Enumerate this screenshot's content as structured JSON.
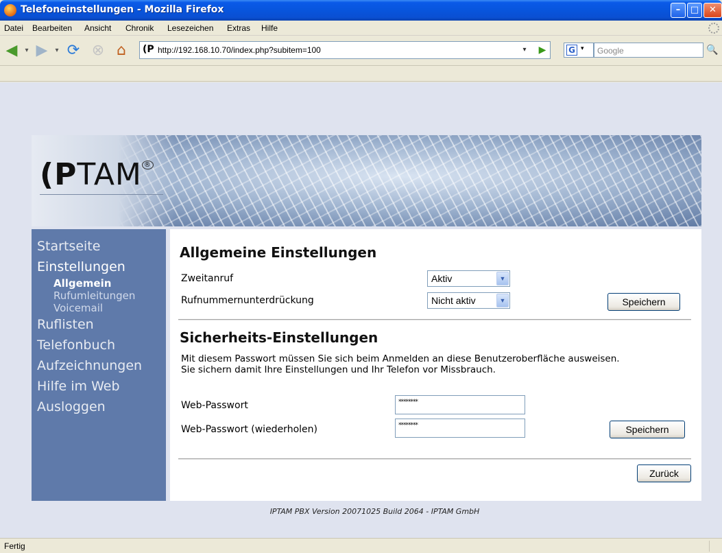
{
  "window": {
    "title": "Telefoneinstellungen - Mozilla Firefox",
    "buttons": {
      "minimize": "–",
      "maximize": "□",
      "close": "✕"
    }
  },
  "menu": [
    "Datei",
    "Bearbeiten",
    "Ansicht",
    "Chronik",
    "Lesezeichen",
    "Extras",
    "Hilfe"
  ],
  "nav": {
    "url": "http://192.168.10.70/index.php?subitem=100",
    "search_placeholder": "Google",
    "icons": {
      "back": "◀",
      "drop": "▾",
      "forward": "▶",
      "reload": "⟳",
      "stop": "⊗",
      "home": "⌂",
      "favicon": "(P",
      "go": "▶",
      "search_engine": "G",
      "search": "🔍"
    }
  },
  "logo": {
    "bold": "(P",
    "light": "TAM",
    "registered": "®"
  },
  "sidebar": {
    "items": [
      {
        "label": "Startseite",
        "active": false
      },
      {
        "label": "Einstellungen",
        "active": true
      },
      {
        "label": "Ruflisten",
        "active": false
      },
      {
        "label": "Telefonbuch",
        "active": false
      },
      {
        "label": "Aufzeichnungen",
        "active": false
      },
      {
        "label": "Hilfe im Web",
        "active": false
      },
      {
        "label": "Ausloggen",
        "active": false
      }
    ],
    "subitems": [
      {
        "label": "Allgemein",
        "active": true
      },
      {
        "label": "Rufumleitungen",
        "active": false
      },
      {
        "label": "Voicemail",
        "active": false
      }
    ]
  },
  "general": {
    "title": "Allgemeine Einstellungen",
    "call_waiting_label": "Zweitanruf",
    "call_waiting_value": "Aktiv",
    "clir_label": "Rufnummernunterdrückung",
    "clir_value": "Nicht aktiv",
    "save_label": "Speichern",
    "select_arrow": "▼"
  },
  "security": {
    "title": "Sicherheits-Einstellungen",
    "description": "Mit diesem Passwort müssen Sie sich beim Anmelden an diese Benutzeroberfläche ausweisen. Sie sichern damit Ihre Einstellungen und Ihr Telefon vor Missbrauch.",
    "password_label": "Web-Passwort",
    "password_repeat_label": "Web-Passwort (wiederholen)",
    "password_value": "********",
    "save_label": "Speichern"
  },
  "back_label": "Zurück",
  "footer": "IPTAM PBX Version 20071025 Build 2064 - IPTAM GmbH",
  "status": "Fertig"
}
